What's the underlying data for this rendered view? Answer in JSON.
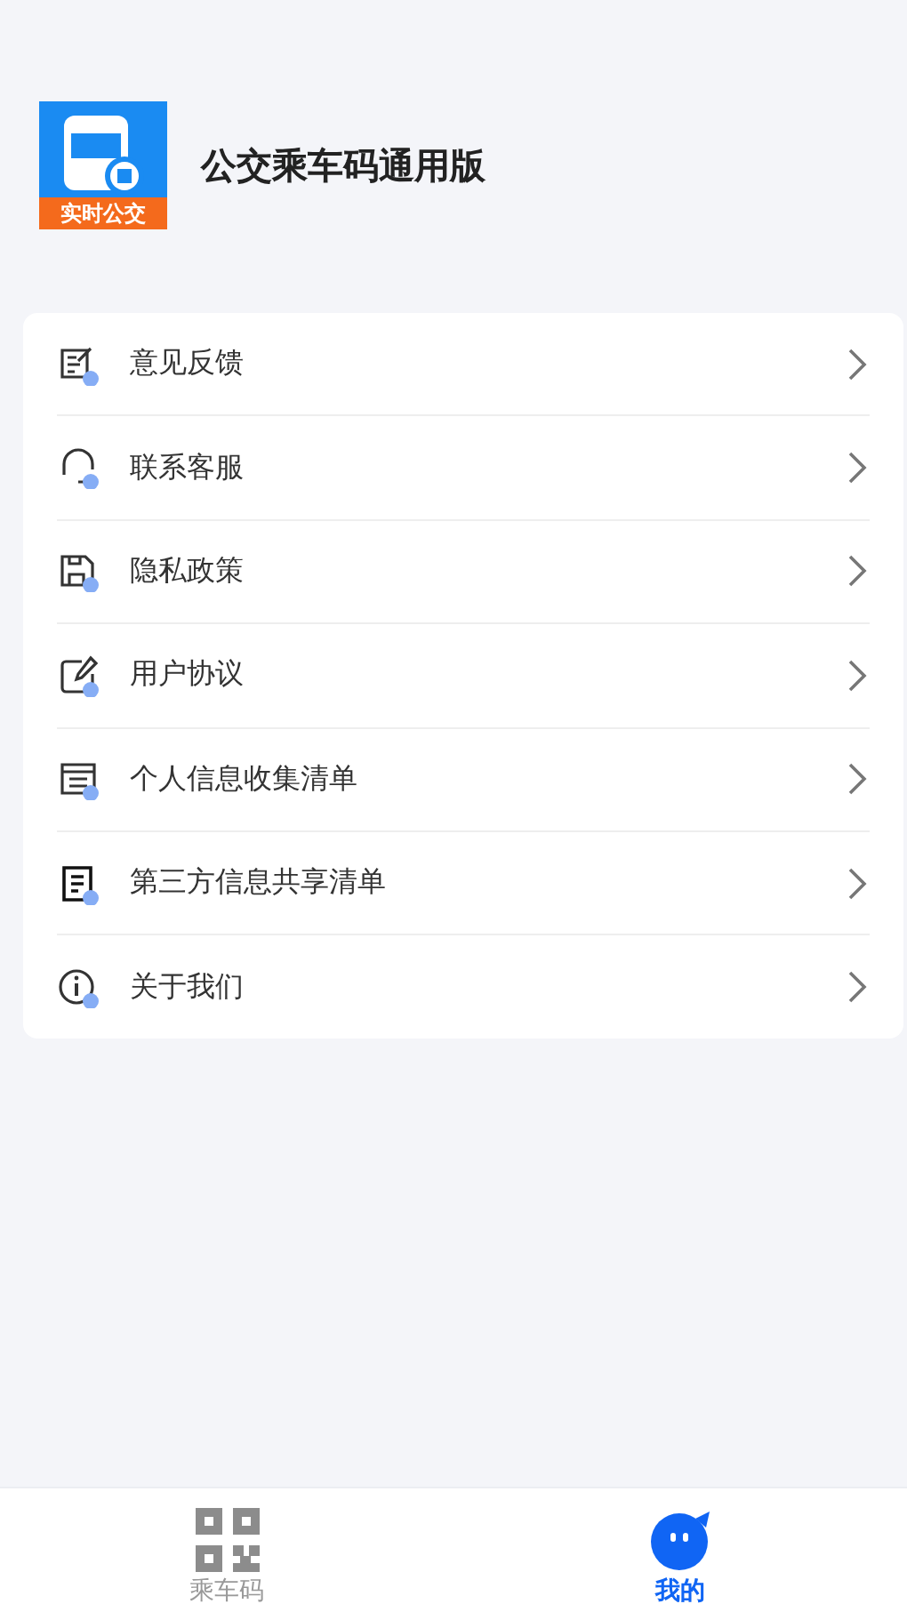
{
  "app": {
    "logo_badge": "实时公交",
    "title": "公交乘车码通用版"
  },
  "menu": [
    {
      "kind": "feedback",
      "label": "意见反馈"
    },
    {
      "kind": "service",
      "label": "联系客服"
    },
    {
      "kind": "privacy",
      "label": "隐私政策"
    },
    {
      "kind": "agreement",
      "label": "用户协议"
    },
    {
      "kind": "personal-info",
      "label": "个人信息收集清单"
    },
    {
      "kind": "third-party",
      "label": "第三方信息共享清单"
    },
    {
      "kind": "about",
      "label": "关于我们"
    }
  ],
  "tab_bar": [
    {
      "kind": "qr",
      "label": "乘车码",
      "selected": false
    },
    {
      "kind": "mine",
      "label": "我的",
      "selected": true
    }
  ]
}
